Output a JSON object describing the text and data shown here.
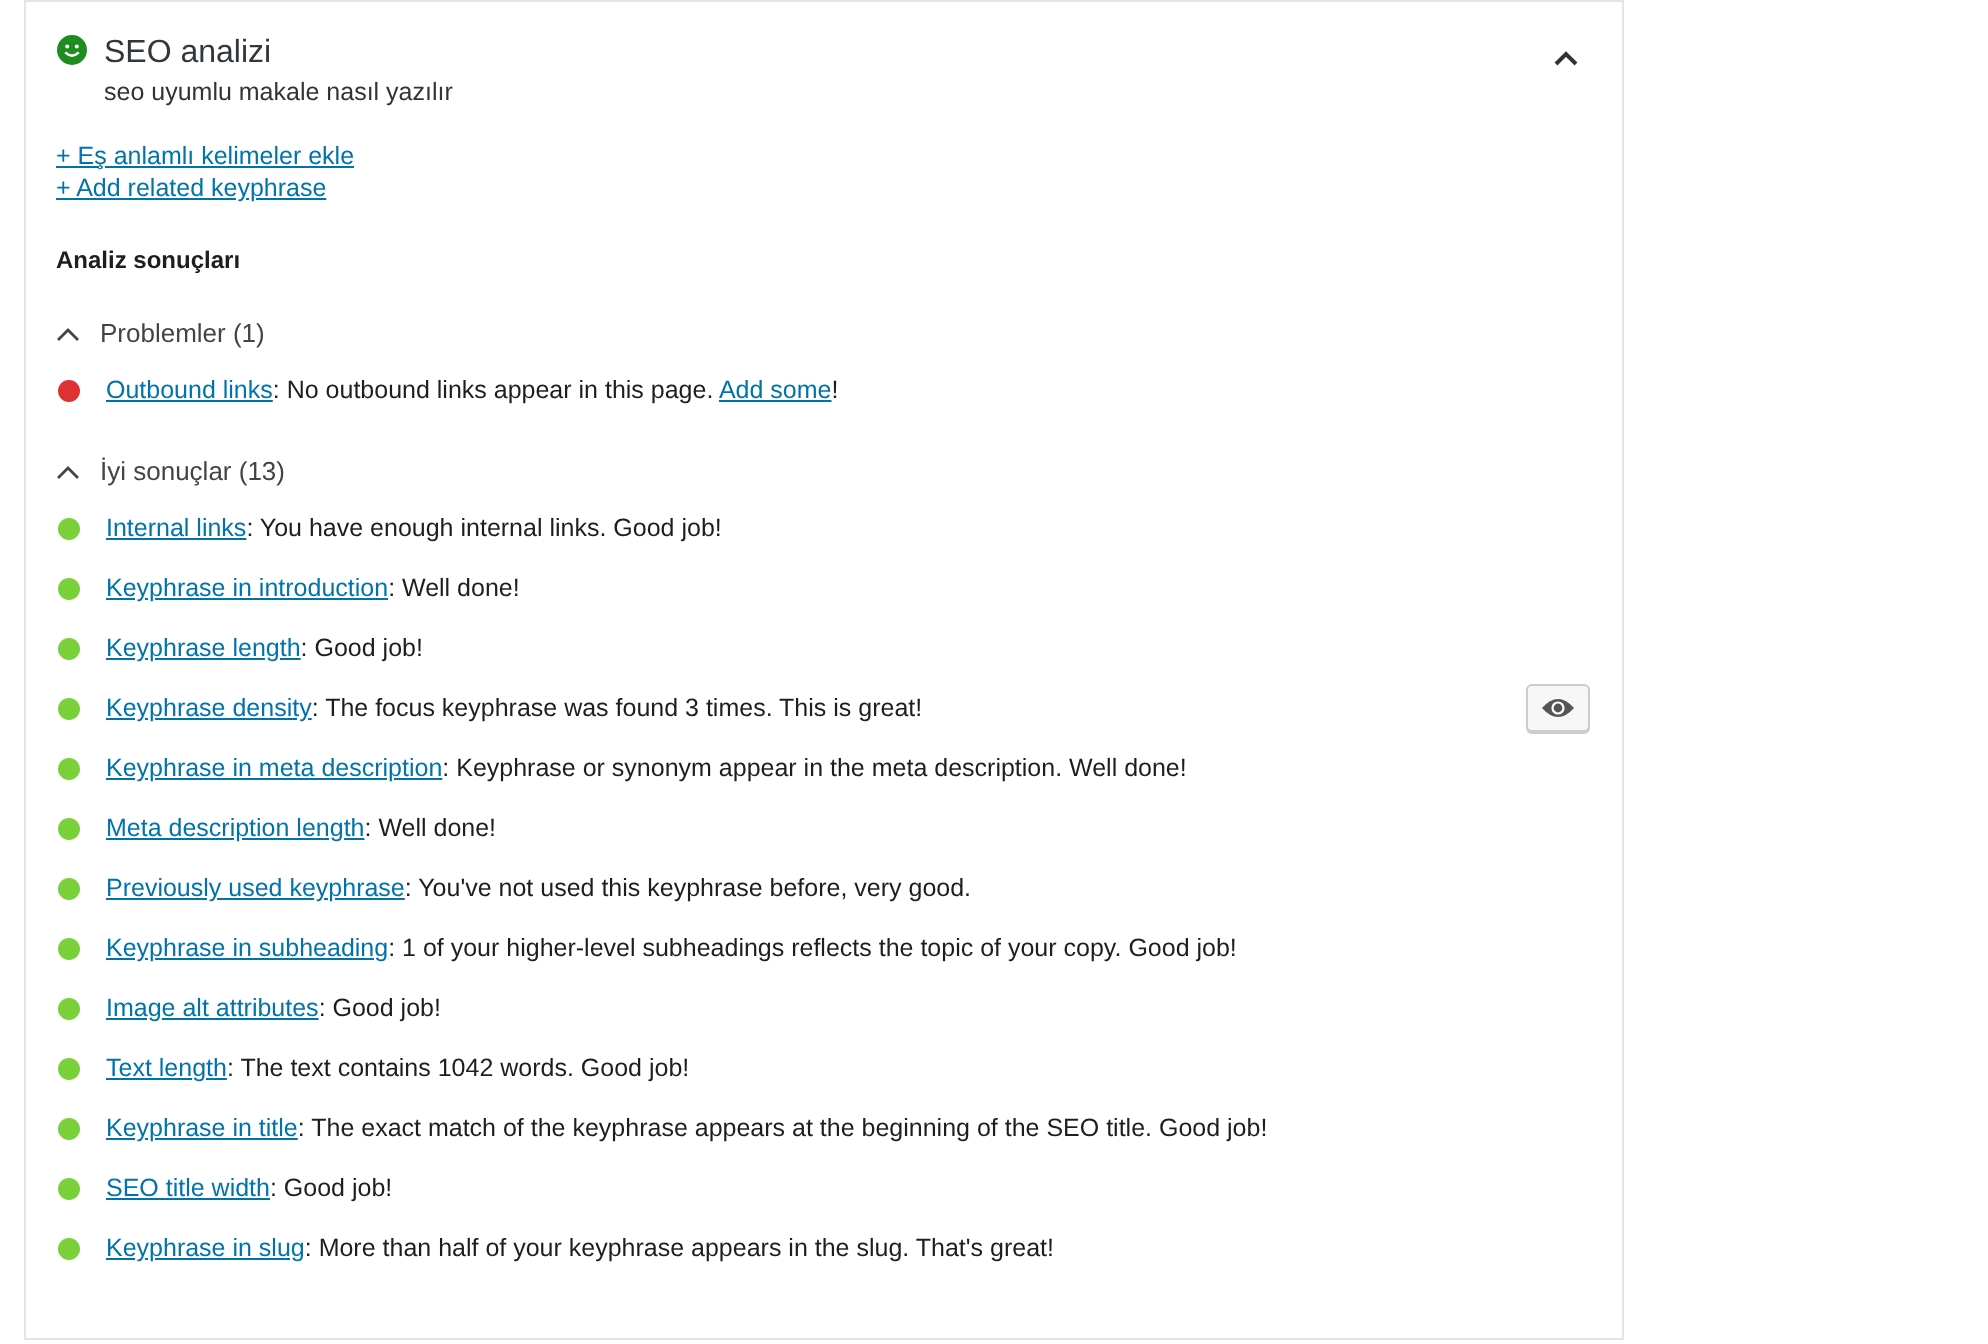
{
  "panel": {
    "title": "SEO analizi",
    "subtitle": "seo uyumlu makale nasıl yazılır",
    "expanded": true,
    "good": true
  },
  "links": [
    "+ Eş anlamlı kelimeler ekle",
    "+ Add related keyphrase"
  ],
  "results_heading": "Analiz sonuçları",
  "groups": [
    {
      "label": "Problemler (1)",
      "expanded": true,
      "items": [
        {
          "color": "#dc3232",
          "link": "Outbound links",
          "text": ": No outbound links appear in this page. ",
          "action": "Add some",
          "tail": "!",
          "marker_button": false
        }
      ]
    },
    {
      "label": "İyi sonuçlar (13)",
      "expanded": true,
      "items": [
        {
          "color": "#7ad03a",
          "link": "Internal links",
          "text": ": You have enough internal links. Good job!",
          "marker_button": false
        },
        {
          "color": "#7ad03a",
          "link": "Keyphrase in introduction",
          "text": ": Well done!",
          "marker_button": false
        },
        {
          "color": "#7ad03a",
          "link": "Keyphrase length",
          "text": ": Good job!",
          "marker_button": false
        },
        {
          "color": "#7ad03a",
          "link": "Keyphrase density",
          "text": ": The focus keyphrase was found 3 times. This is great!",
          "marker_button": true
        },
        {
          "color": "#7ad03a",
          "link": "Keyphrase in meta description",
          "text": ": Keyphrase or synonym appear in the meta description. Well done!",
          "marker_button": false
        },
        {
          "color": "#7ad03a",
          "link": "Meta description length",
          "text": ": Well done!",
          "marker_button": false
        },
        {
          "color": "#7ad03a",
          "link": "Previously used keyphrase",
          "text": ": You've not used this keyphrase before, very good.",
          "marker_button": false
        },
        {
          "color": "#7ad03a",
          "link": "Keyphrase in subheading",
          "text": ": 1 of your higher-level subheadings reflects the topic of your copy. Good job!",
          "marker_button": false
        },
        {
          "color": "#7ad03a",
          "link": "Image alt attributes",
          "text": ": Good job!",
          "marker_button": false
        },
        {
          "color": "#7ad03a",
          "link": "Text length",
          "text": ": The text contains 1042 words. Good job!",
          "marker_button": false
        },
        {
          "color": "#7ad03a",
          "link": "Keyphrase in title",
          "text": ": The exact match of the keyphrase appears at the beginning of the SEO title. Good job!",
          "marker_button": false
        },
        {
          "color": "#7ad03a",
          "link": "SEO title width",
          "text": ": Good job!",
          "marker_button": false
        },
        {
          "color": "#7ad03a",
          "link": "Keyphrase in slug",
          "text": ": More than half of your keyphrase appears in the slug. That's great!",
          "marker_button": false
        }
      ]
    }
  ]
}
